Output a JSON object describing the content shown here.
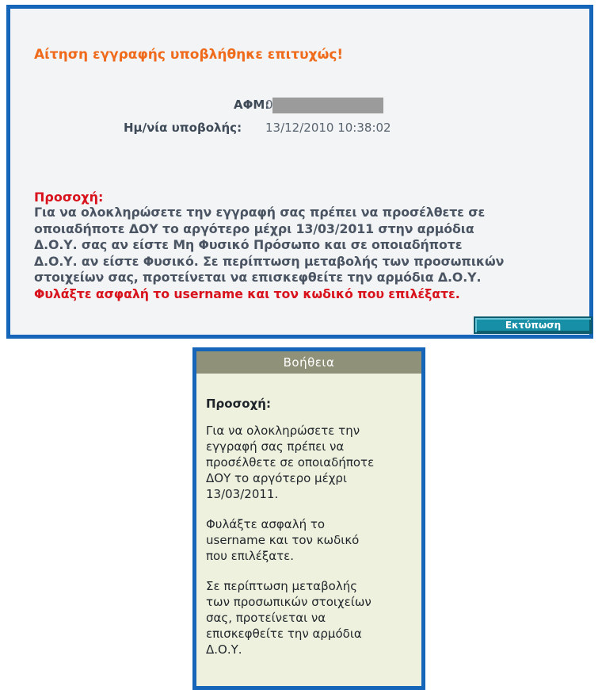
{
  "confirmation": {
    "title": "Αίτηση εγγραφής υποβλήθηκε επιτυχώς!",
    "afm_label": "ΑΦΜ:",
    "afm_value": "0",
    "submission_date_label": "Ημ/νία υποβολής:",
    "submission_date_value": "13/12/2010 10:38:02",
    "warning_heading": "Προσοχή:",
    "warning_lines": [
      "Για να ολοκληρώσετε την εγγραφή σας πρέπει να προσέλθετε σε",
      "οποιαδήποτε ΔΟΥ το αργότερο μέχρι 13/03/2011 στην αρμόδια",
      "Δ.Ο.Υ. σας αν είστε Μη Φυσικό Πρόσωπο και σε οποιαδήποτε",
      "Δ.Ο.Υ. αν είστε Φυσικό. Σε περίπτωση μεταβολής των προσωπικών",
      "στοιχείων σας, προτείνεται να επισκεφθείτε την αρμόδια Δ.Ο.Υ."
    ],
    "warning_emphasis": "Φυλάξτε ασφαλή το username και τον κωδικό που επιλέξατε.",
    "print_button_label": "Εκτύπωση"
  },
  "help": {
    "header": "Βοήθεια",
    "heading": "Προσοχή:",
    "paragraph1_lines": [
      "Για να ολοκληρώσετε την",
      "εγγραφή σας πρέπει να",
      "προσέλθετε σε οποιαδήποτε",
      "ΔΟΥ το αργότερο μέχρι",
      "13/03/2011."
    ],
    "paragraph2_lines": [
      "Φυλάξτε ασφαλή το",
      "username και τον κωδικό",
      "που επιλέξατε."
    ],
    "paragraph3_lines": [
      "Σε περίπτωση μεταβολής",
      "των προσωπικών στοιχείων",
      "σας, προτείνεται να",
      "επισκεφθείτε την αρμόδια",
      "Δ.Ο.Υ."
    ]
  },
  "colors": {
    "panel_border": "#1565b8",
    "title_orange": "#ef6a1a",
    "warning_red": "#d9131d",
    "button_teal": "#178fa6",
    "help_header_bg": "#8f9279",
    "help_bg": "#eef1dd"
  }
}
